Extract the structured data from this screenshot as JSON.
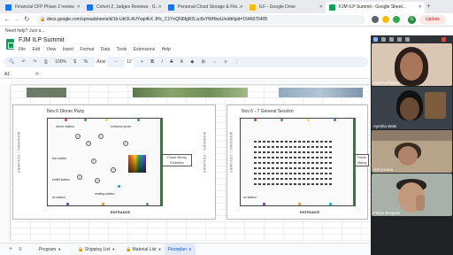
{
  "browser": {
    "tabs": [
      {
        "label": "Financial CFP Phase 2 review",
        "color": "#1a73e8"
      },
      {
        "label": "Cohort 2, Judges Reviews - G...",
        "color": "#1a73e8"
      },
      {
        "label": "Personal Cloud Storage & File...",
        "color": "#1a73e8"
      },
      {
        "label": "ILF - Google Drive",
        "color": "#fbbc04"
      },
      {
        "label": "FJM ILP Summit - Google Sheet...",
        "color": "#0f9d58"
      }
    ],
    "new_tab": "+",
    "url": "docs.google.com/spreadsheets/d/1b-UbOL4tJYsqi4kX JHc_C1YnQN6fgR2Lq-8xYWHboU/edit#gid=1546076405",
    "avatar_letter": "G",
    "update_label": "Update",
    "bookmark": "Need help? Just a..."
  },
  "sheet": {
    "title": "FJM ILP Summit",
    "menus": [
      "File",
      "Edit",
      "View",
      "Insert",
      "Format",
      "Data",
      "Tools",
      "Extensions",
      "Help"
    ],
    "toolbar": {
      "zoom": "100%",
      "font": "Arial",
      "font_size": "12"
    },
    "cell_ref": "A1",
    "fx": "fx"
  },
  "floorplans": {
    "left": {
      "title": "Nov 6 Dinner Party",
      "stage_label": "Future Mixing Exhibition",
      "label_dinner": "dinner station",
      "label_entrance_photo": "entrance photo",
      "label_bar": "bar station",
      "label_buffet": "buffet station",
      "label_av": "av station",
      "label_seating": "seating station",
      "side_text": "WINDOWS / COLUMNS",
      "entrance": "ENTRANCE"
    },
    "right": {
      "title": "Nov 6 - 7 General Session",
      "stage_label": "Future Mixing Exhibition",
      "label_av": "av station",
      "side_text": "WINDOWS / COLUMNS",
      "entrance": "ENTRANCE"
    }
  },
  "sheet_tabs": [
    {
      "label": "Program",
      "active": false
    },
    {
      "label": "Shipping List",
      "active": false
    },
    {
      "label": "Material List",
      "active": false
    },
    {
      "label": "Floorplan",
      "active": true
    }
  ],
  "meet": {
    "participants": [
      {
        "name": "Ana Rodriguez",
        "bg": "#d9c7b3"
      },
      {
        "name": "Ayesha Wats",
        "bg": "#3b4148"
      },
      {
        "name": "Izel Iyrama",
        "bg": "#b7a28a"
      },
      {
        "name": "Felipe Brugues",
        "bg": "#a8b0aa"
      }
    ]
  }
}
